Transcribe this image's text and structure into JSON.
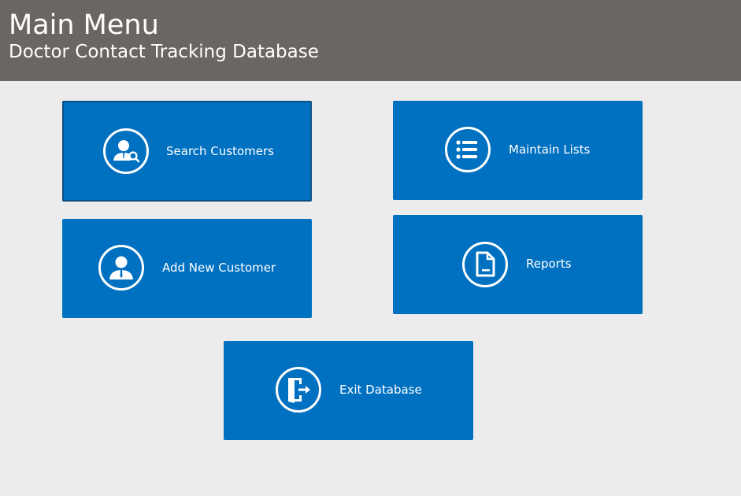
{
  "header": {
    "title": "Main Menu",
    "subtitle": "Doctor Contact Tracking Database"
  },
  "tiles": {
    "search_customers": {
      "label": "Search Customers",
      "icon": "user-search-icon"
    },
    "maintain_lists": {
      "label": "Maintain Lists",
      "icon": "list-icon"
    },
    "add_new_customer": {
      "label": "Add New Customer",
      "icon": "user-icon"
    },
    "reports": {
      "label": "Reports",
      "icon": "document-icon"
    },
    "exit_database": {
      "label": "Exit Database",
      "icon": "exit-door-icon"
    }
  },
  "colors": {
    "header_bg": "#6b6661",
    "page_bg": "#ececec",
    "tile_bg": "#0070c0",
    "text": "#ffffff"
  }
}
